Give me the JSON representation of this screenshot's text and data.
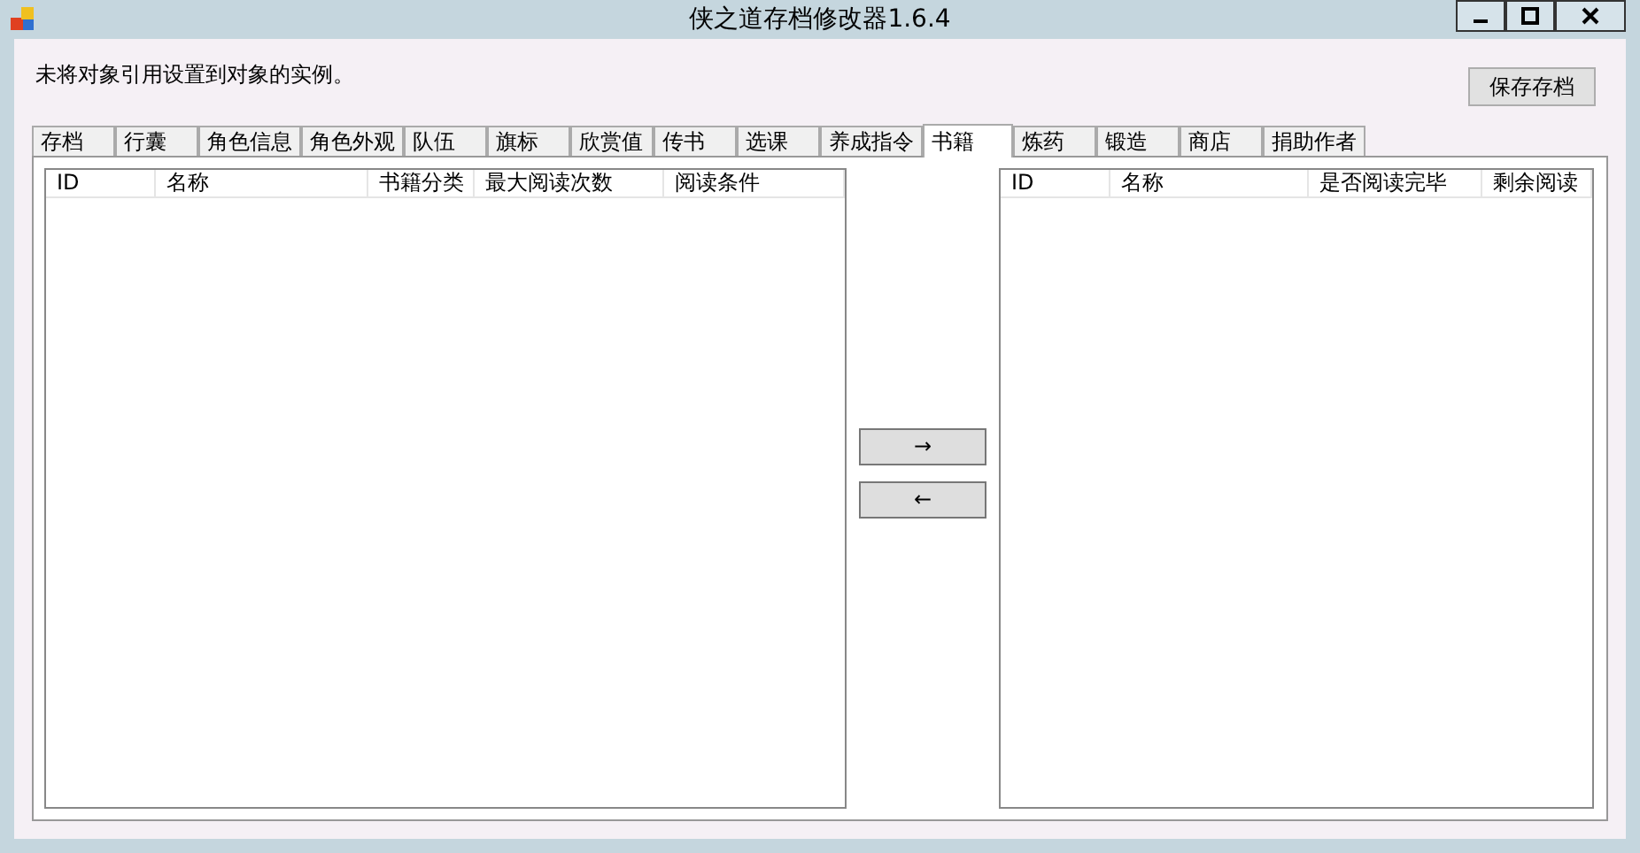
{
  "window": {
    "title": "侠之道存档修改器1.6.4"
  },
  "message": "未将对象引用设置到对象的实例。",
  "save_button": "保存存档",
  "tabs": [
    {
      "label": "存档",
      "selected": false
    },
    {
      "label": "行囊",
      "selected": false
    },
    {
      "label": "角色信息",
      "selected": false
    },
    {
      "label": "角色外观",
      "selected": false
    },
    {
      "label": "队伍",
      "selected": false
    },
    {
      "label": "旗标",
      "selected": false
    },
    {
      "label": "欣赏值",
      "selected": false
    },
    {
      "label": "传书",
      "selected": false
    },
    {
      "label": "选课",
      "selected": false
    },
    {
      "label": "养成指令",
      "selected": false
    },
    {
      "label": "书籍",
      "selected": true
    },
    {
      "label": "炼药",
      "selected": false
    },
    {
      "label": "锻造",
      "selected": false
    },
    {
      "label": "商店",
      "selected": false
    },
    {
      "label": "捐助作者",
      "selected": false
    }
  ],
  "left_table": {
    "columns": [
      "ID",
      "名称",
      "书籍分类",
      "最大阅读次数",
      "阅读条件"
    ]
  },
  "right_table": {
    "columns": [
      "ID",
      "名称",
      "是否阅读完毕",
      "剩余阅读"
    ]
  },
  "transfer_buttons": [
    "→",
    "←"
  ]
}
